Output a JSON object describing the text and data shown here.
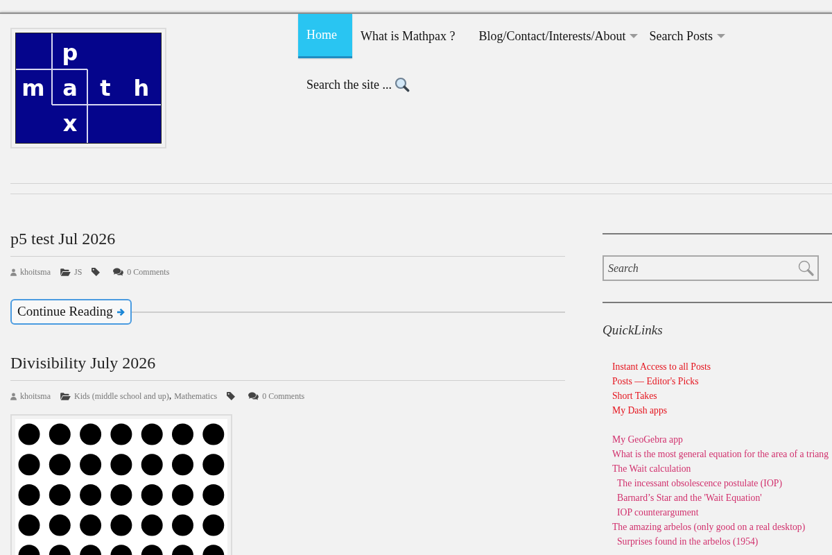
{
  "logo": {
    "letters": [
      "p",
      "m",
      "a",
      "t",
      "h",
      "x"
    ]
  },
  "nav": [
    {
      "label": "Home",
      "kind": "link",
      "selected": true,
      "dropdown": false
    },
    {
      "label": "What is Mathpax ?",
      "kind": "link",
      "selected": false,
      "dropdown": false
    },
    {
      "label": "Blog/Contact/Interests/About",
      "kind": "link",
      "selected": false,
      "dropdown": true
    },
    {
      "label": "Search Posts",
      "kind": "link",
      "selected": false,
      "dropdown": true
    },
    {
      "label": "Search the site ...",
      "kind": "search",
      "selected": false,
      "dropdown": false
    }
  ],
  "posts": [
    {
      "title": "p5 test Jul 2026",
      "author": "khoitsma",
      "categories": [
        "JS"
      ],
      "comments": "0 Comments",
      "continue_label": "Continue Reading",
      "has_image": false
    },
    {
      "title": "Divisibility July 2026",
      "author": "khoitsma",
      "categories": [
        "Kids (middle school and up)",
        "Mathematics"
      ],
      "category_separator": ",",
      "comments": "0 Comments",
      "has_image": true
    }
  ],
  "sidebar": {
    "search": {
      "placeholder": "Search"
    },
    "quicklinks": {
      "title": "QuickLinks",
      "groups": [
        {
          "links": [
            {
              "label": "Instant Access to all Posts",
              "color": "#e5121c"
            },
            {
              "label": "Posts — Editor's Picks",
              "color": "#e5121c"
            },
            {
              "label": "Short Takes",
              "color": "#e5121c"
            },
            {
              "label": "My Dash apps",
              "color": "#e5121c"
            }
          ]
        },
        {
          "links": [
            {
              "label": "My GeoGebra app",
              "color": "#d12f6c"
            },
            {
              "label": "What is the most general equation for the area of a triang",
              "color": "#d12f6c"
            },
            {
              "label": "The Wait calculation",
              "color": "#d12f6c",
              "children": [
                {
                  "label": "The incessant obsolescence postulate (IOP)",
                  "color": "#d12f6c"
                },
                {
                  "label": "Barnard’s Star and the 'Wait Equation'",
                  "color": "#d12f6c"
                },
                {
                  "label": "IOP counterargument",
                  "color": "#d12f6c"
                }
              ]
            },
            {
              "label": "The amazing arbelos (only good on a real desktop)",
              "color": "#d12f6c",
              "children": [
                {
                  "label": "Surprises found in the arbelos (1954)",
                  "color": "#d12f6c"
                }
              ]
            }
          ]
        }
      ]
    }
  }
}
